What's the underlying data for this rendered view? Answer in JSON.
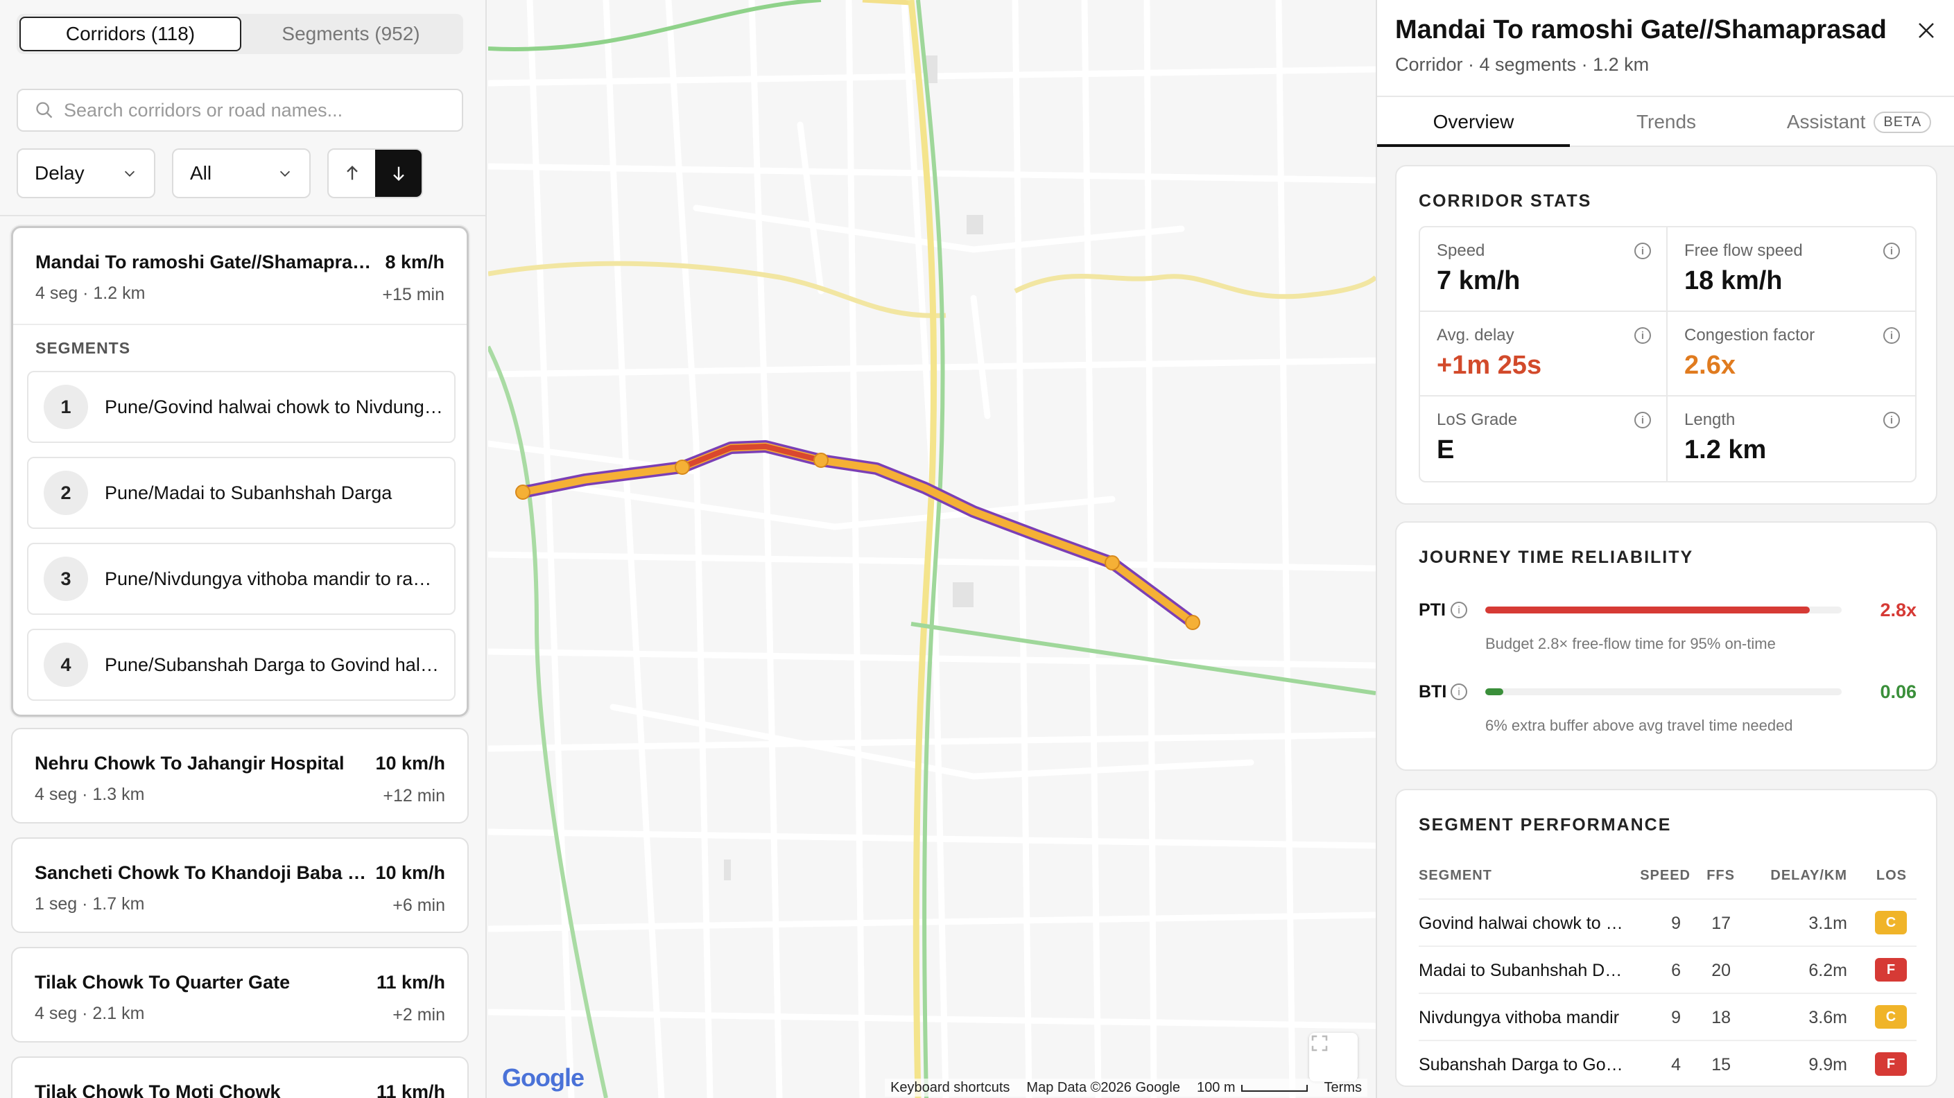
{
  "sidebar": {
    "toggle": {
      "corridors_label": "Corridors (118)",
      "segments_label": "Segments (952)"
    },
    "search": {
      "placeholder": "Search corridors or road names..."
    },
    "filters": {
      "sort_by": "Delay",
      "category": "All"
    },
    "selected_corridor": {
      "title": "Mandai To ramoshi Gate//Shamaprasad",
      "speed": "8 km/h",
      "meta": "4 seg · 1.2 km",
      "delay": "+15 min",
      "segments_header": "SEGMENTS",
      "segments": [
        {
          "num": "1",
          "name": "Pune/Govind halwai chowk to Nivdungya vithoba mandir"
        },
        {
          "num": "2",
          "name": "Pune/Madai to Subanhshah Darga"
        },
        {
          "num": "3",
          "name": "Pune/Nivdungya vithoba mandir to ramoshi gate"
        },
        {
          "num": "4",
          "name": "Pune/Subanshah Darga to Govind halwai chowk"
        }
      ]
    },
    "corridors": [
      {
        "title": "Nehru Chowk To Jahangir Hospital",
        "speed": "10 km/h",
        "meta": "4 seg · 1.3 km",
        "delay": "+12 min"
      },
      {
        "title": "Sancheti Chowk To Khandoji Baba Chowk",
        "speed": "10 km/h",
        "meta": "1 seg · 1.7 km",
        "delay": "+6 min"
      },
      {
        "title": "Tilak Chowk To Quarter Gate",
        "speed": "11 km/h",
        "meta": "4 seg · 2.1 km",
        "delay": "+2 min"
      },
      {
        "title": "Tilak Chowk To Moti Chowk",
        "speed": "11 km/h",
        "meta": "",
        "delay": ""
      }
    ]
  },
  "map": {
    "logo": "Google",
    "attribution": {
      "shortcuts": "Keyboard shortcuts",
      "data": "Map Data ©2026 Google",
      "scale": "100 m",
      "terms": "Terms"
    }
  },
  "panel": {
    "title": "Mandai To ramoshi Gate//Shamaprasad",
    "subtitle": "Corridor · 4 segments · 1.2 km",
    "tabs": {
      "overview": "Overview",
      "trends": "Trends",
      "assistant": "Assistant",
      "beta": "BETA"
    },
    "stats": {
      "heading": "CORRIDOR STATS",
      "items": [
        {
          "label": "Speed",
          "value": "7 km/h",
          "color": "#111111"
        },
        {
          "label": "Free flow speed",
          "value": "18 km/h",
          "color": "#111111"
        },
        {
          "label": "Avg. delay",
          "value": "+1m 25s",
          "color": "#d24a2b"
        },
        {
          "label": "Congestion factor",
          "value": "2.6x",
          "color": "#e07b1f"
        },
        {
          "label": "LoS Grade",
          "value": "E",
          "color": "#111111"
        },
        {
          "label": "Length",
          "value": "1.2 km",
          "color": "#111111"
        }
      ]
    },
    "reliability": {
      "heading": "JOURNEY TIME RELIABILITY",
      "pti": {
        "label": "PTI",
        "value": "2.8x",
        "fill_fraction": 0.91,
        "color": "#d63a35",
        "note": "Budget 2.8× free-flow time for 95% on-time"
      },
      "bti": {
        "label": "BTI",
        "value": "0.06",
        "fill_fraction": 0.05,
        "color": "#3a8f3a",
        "note": "6% extra buffer above avg travel time needed"
      }
    },
    "performance": {
      "heading": "SEGMENT PERFORMANCE",
      "columns": [
        "SEGMENT",
        "SPEED",
        "FFS",
        "DELAY/KM",
        "LOS"
      ],
      "rows": [
        {
          "segment": "Govind halwai chowk to Nivdungya",
          "speed": "9",
          "ffs": "17",
          "delay": "3.1m",
          "los": "C",
          "los_color": "#f0b429"
        },
        {
          "segment": "Madai to Subanhshah Darga",
          "speed": "6",
          "ffs": "20",
          "delay": "6.2m",
          "los": "F",
          "los_color": "#d63a35"
        },
        {
          "segment": "Nivdungya vithoba mandir",
          "speed": "9",
          "ffs": "18",
          "delay": "3.6m",
          "los": "C",
          "los_color": "#f0b429"
        },
        {
          "segment": "Subanshah Darga to Govind",
          "speed": "4",
          "ffs": "15",
          "delay": "9.9m",
          "los": "F",
          "los_color": "#d63a35"
        }
      ]
    }
  }
}
